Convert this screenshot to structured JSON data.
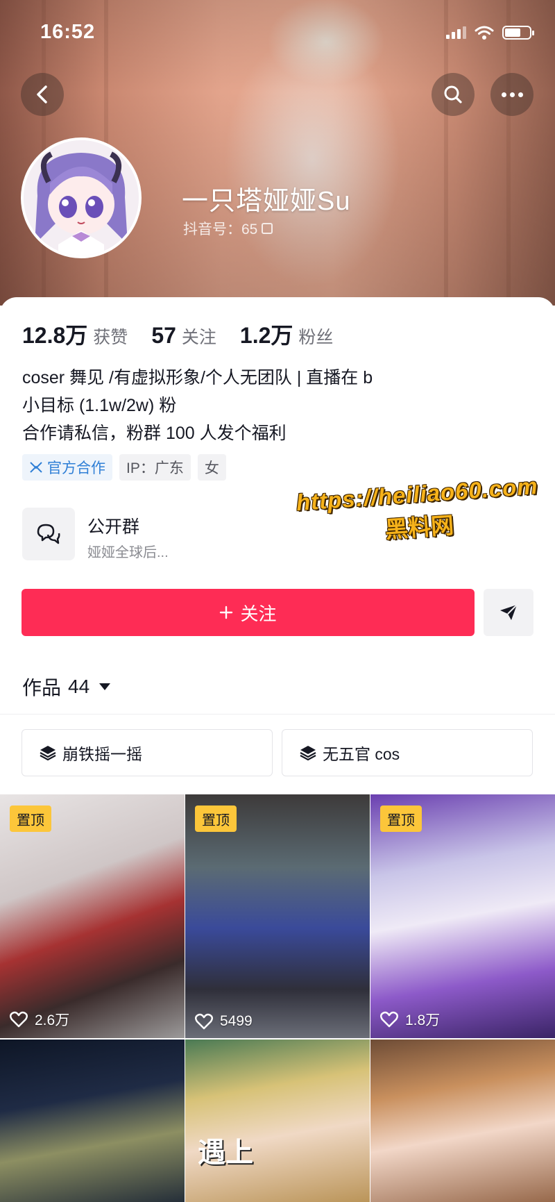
{
  "status_bar": {
    "time": "16:52"
  },
  "profile": {
    "nickname": "一只塔娅娅Su",
    "douyin_id": "抖音号：65",
    "stats": [
      {
        "value": "12.8万",
        "label": "获赞"
      },
      {
        "value": "57",
        "label": "关注"
      },
      {
        "value": "1.2万",
        "label": "粉丝"
      }
    ],
    "bio_lines": [
      "coser 舞见 /有虚拟形象/个人无团队 | 直播在 b",
      "小目标 (1.1w/2w) 粉",
      "合作请私信，粉群 100 人发个福利"
    ],
    "tags": [
      "官方合作",
      "IP：广东",
      "女"
    ]
  },
  "group": {
    "title": "公开群",
    "subtitle": "娅娅全球后..."
  },
  "watermark": {
    "url": "https://heiliao60.com",
    "name": "黑料网"
  },
  "actions": {
    "follow_label": "关注"
  },
  "works": {
    "label": "作品",
    "count": "44",
    "collections": [
      "崩铁摇一摇",
      "无五官 cos"
    ],
    "videos": [
      {
        "pinned": true,
        "pin_label": "置顶",
        "likes": "2.6万"
      },
      {
        "pinned": true,
        "pin_label": "置顶",
        "likes": "5499"
      },
      {
        "pinned": true,
        "pin_label": "置顶",
        "likes": "1.8万"
      },
      {
        "pinned": false,
        "likes": ""
      },
      {
        "pinned": false,
        "likes": "",
        "overlay_text": "遇上"
      },
      {
        "pinned": false,
        "likes": ""
      }
    ]
  },
  "colors": {
    "accent": "#fe2c55",
    "pin_badge": "#fcc63a",
    "official_tag": "#2f7fd6",
    "watermark": "#f6b21a"
  },
  "icons": [
    "back-arrow-icon",
    "search-icon",
    "more-icon",
    "copy-icon",
    "official-icon",
    "chat-bubble-icon",
    "plus-icon",
    "share-arrow-icon",
    "collection-stack-icon",
    "heart-icon",
    "dropdown-triangle-icon",
    "signal-icon",
    "wifi-icon",
    "battery-icon"
  ]
}
